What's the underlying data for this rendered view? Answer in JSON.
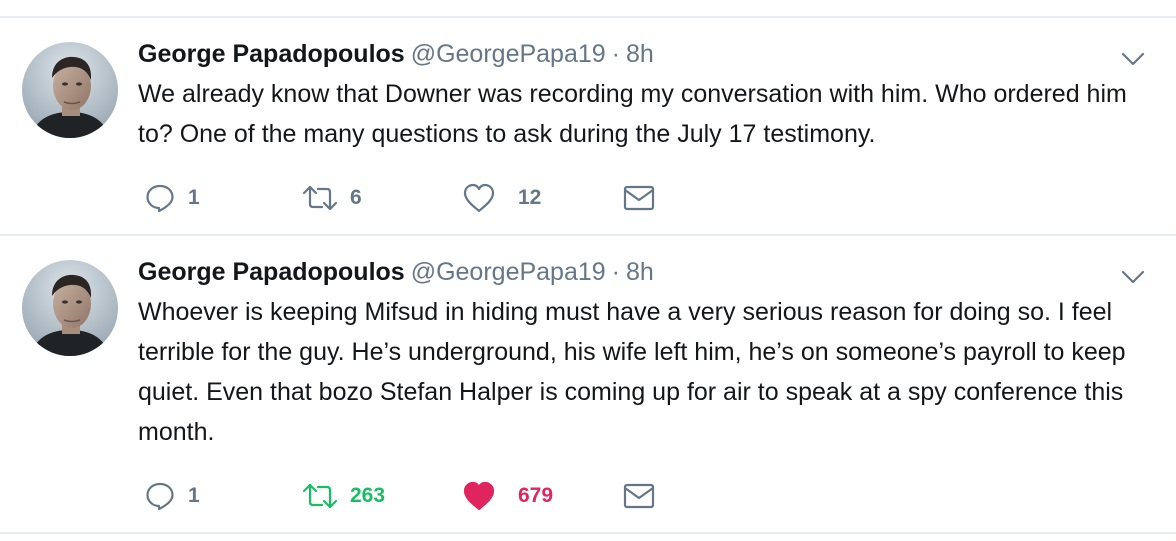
{
  "colors": {
    "text": "#14171a",
    "secondary": "#657786",
    "retweeted": "#17bf63",
    "liked": "#e0245e",
    "divider": "#e6ecf0"
  },
  "tweets": [
    {
      "author": {
        "name": "George Papadopoulos",
        "handle": "@GeorgePapa19"
      },
      "separator": "·",
      "time": "8h",
      "text": "We already know that Downer was recording my conversation with him. Who ordered him to? One of the many questions to ask during the July 17 testimony.",
      "stats": {
        "replies": "1",
        "retweets": "6",
        "likes": "12"
      },
      "retweeted": false,
      "liked": false,
      "icons": [
        "reply-icon",
        "retweet-icon",
        "heart-outline-icon",
        "message-icon",
        "chevron-down-icon"
      ]
    },
    {
      "author": {
        "name": "George Papadopoulos",
        "handle": "@GeorgePapa19"
      },
      "separator": "·",
      "time": "8h",
      "text": "Whoever is keeping Mifsud in hiding must have a very serious reason for doing so. I feel terrible for the guy. He’s underground, his wife left him, he’s on someone’s payroll to keep quiet. Even that bozo Stefan Halper is coming up for air to speak at a spy conference this month.",
      "stats": {
        "replies": "1",
        "retweets": "263",
        "likes": "679"
      },
      "retweeted": true,
      "liked": true,
      "icons": [
        "reply-icon",
        "retweet-icon",
        "heart-filled-icon",
        "message-icon",
        "chevron-down-icon"
      ]
    }
  ]
}
